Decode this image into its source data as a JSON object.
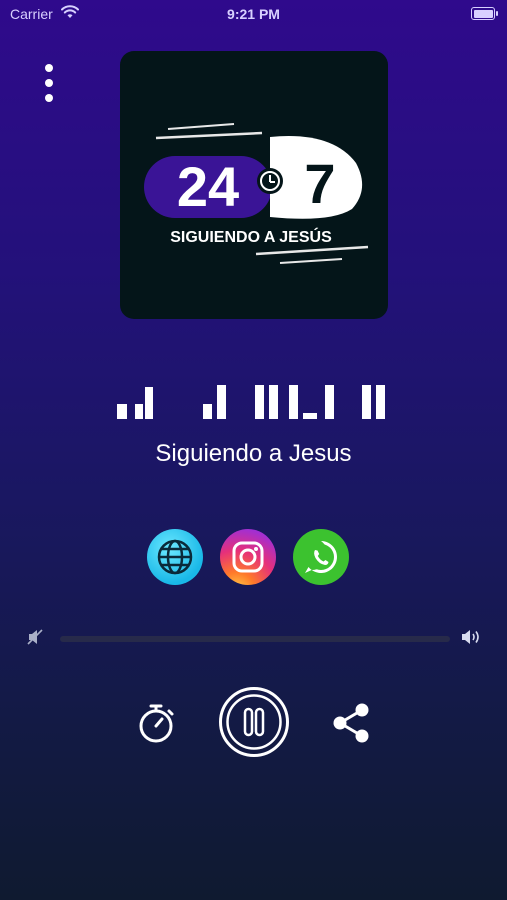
{
  "status_bar": {
    "carrier": "Carrier",
    "time": "9:21 PM"
  },
  "menu": {
    "icon": "more-vertical-icon"
  },
  "cover_art": {
    "number_left": "24",
    "number_right": "7",
    "subtitle": "SIGUIENDO A JESÚS",
    "colors": {
      "background": "#041519",
      "pill": "#3a1496",
      "accent": "#ffffff"
    }
  },
  "audio_visualizer": {
    "levels": [
      0.35,
      0.35,
      0.75,
      0.35,
      0.8,
      0.8,
      0.8,
      0.8,
      0.15,
      0.8,
      0.8,
      0.8
    ]
  },
  "track": {
    "title": "Siguiendo a Jesus"
  },
  "social": [
    {
      "name": "website",
      "icon": "globe-icon",
      "color": "#19b8e8"
    },
    {
      "name": "instagram",
      "icon": "instagram-icon",
      "color": "#e6307a"
    },
    {
      "name": "whatsapp",
      "icon": "whatsapp-icon",
      "color": "#3cc22f"
    }
  ],
  "volume": {
    "level": 0.0,
    "min_icon": "volume-mute-icon",
    "max_icon": "volume-up-icon"
  },
  "controls": {
    "timer_icon": "stopwatch-icon",
    "play_pause_icon": "pause-icon",
    "share_icon": "share-icon",
    "state": "playing"
  },
  "theme": {
    "gradient_top": "#2f0a8c",
    "gradient_bottom": "#0f1a30"
  }
}
